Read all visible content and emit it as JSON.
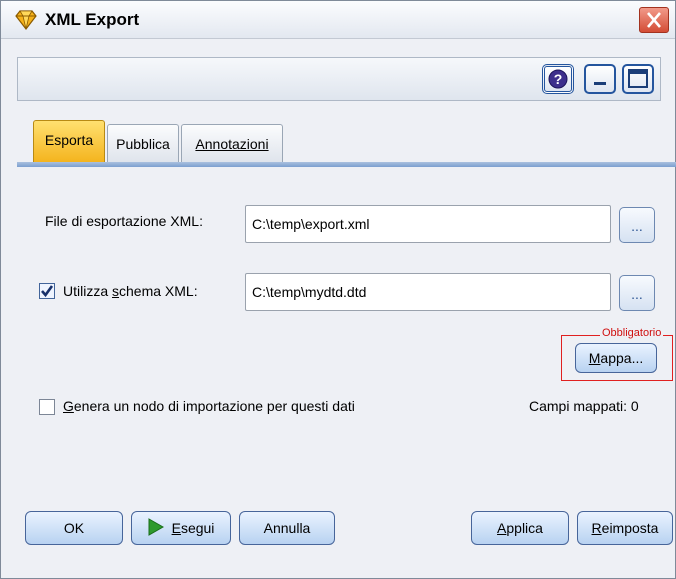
{
  "window": {
    "title": "XML Export"
  },
  "toolbar": {
    "help_icon": "help-icon",
    "minimize_icon": "minimize-icon",
    "maximize_icon": "maximize-icon"
  },
  "tabs": [
    {
      "label": "Esporta",
      "active": true
    },
    {
      "label": "Pubblica",
      "active": false
    },
    {
      "label": "Annotazioni",
      "active": false
    }
  ],
  "export": {
    "file_label": "File di esportazione XML:",
    "file_value": "C:\\temp\\export.xml",
    "schema_checked": true,
    "schema_label_before": "Utilizza ",
    "schema_label_accel": "s",
    "schema_label_after": "chema XML:",
    "schema_value": "C:\\temp\\mydtd.dtd",
    "browse_label": "...",
    "required_label": "Obbligatorio",
    "map_button_accel": "M",
    "map_button_rest": "appa...",
    "generate_checked": false,
    "generate_accel": "G",
    "generate_rest": "enera un nodo di importazione per questi dati",
    "mapped_fields": "Campi mappati: 0"
  },
  "buttons": {
    "ok": "OK",
    "run_accel": "E",
    "run_rest": "segui",
    "cancel": "Annulla",
    "apply_accel": "A",
    "apply_rest": "pplica",
    "reset_accel": "R",
    "reset_rest": "eimposta"
  },
  "colors": {
    "accent": "#f4b41e",
    "run_icon": "#2e9a2e",
    "required": "#e02020"
  }
}
